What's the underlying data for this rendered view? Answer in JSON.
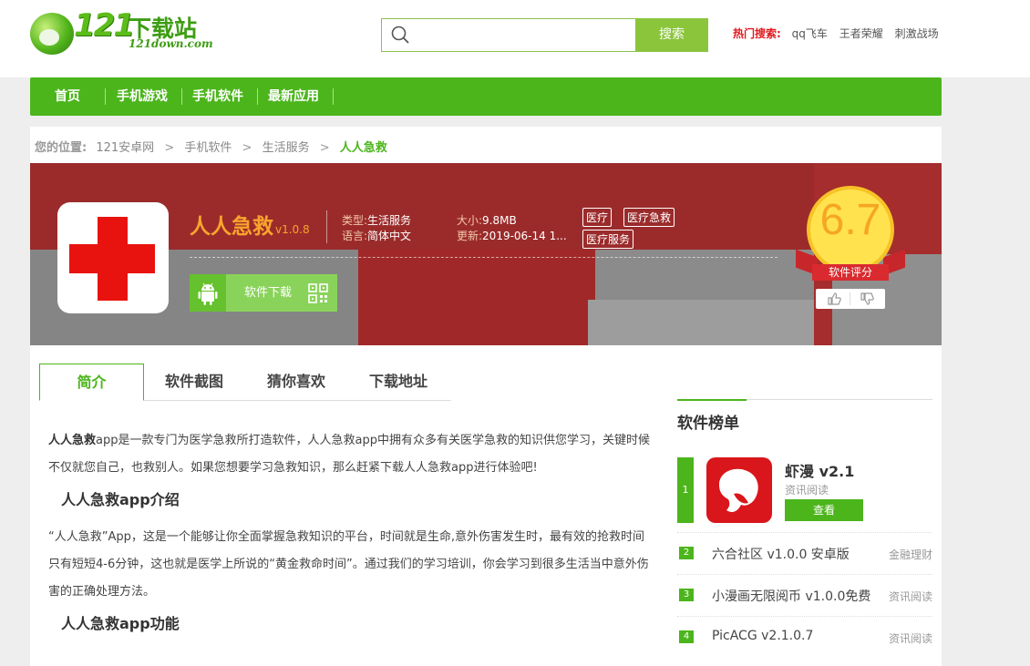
{
  "logo": {
    "number": "121",
    "name": "下载站",
    "domain": "121down.com"
  },
  "search": {
    "placeholder": "",
    "button": "搜索"
  },
  "hot_search": {
    "label": "热门搜索:",
    "items": [
      "qq飞车",
      "王者荣耀",
      "刺激战场"
    ]
  },
  "nav": {
    "items": [
      "首页",
      "手机游戏",
      "手机软件",
      "最新应用"
    ]
  },
  "breadcrumb": {
    "label": "您的位置:",
    "items": [
      "121安卓网",
      "手机软件",
      "生活服务"
    ],
    "current": "人人急救",
    "separator": ">"
  },
  "app": {
    "name": "人人急救",
    "version": "v1.0.8",
    "type_label": "类型:",
    "type": "生活服务",
    "lang_label": "语言:",
    "lang": "简体中文",
    "size_label": "大小:",
    "size": "9.8MB",
    "update_label": "更新:",
    "update": "2019-06-14 1...",
    "tags": [
      "医疗",
      "医疗急救",
      "医疗服务"
    ],
    "download_label": "软件下载",
    "score": "6.7",
    "score_label": "软件评分"
  },
  "tabs": [
    "简介",
    "软件截图",
    "猜你喜欢",
    "下载地址"
  ],
  "content": {
    "intro_bold": "人人急救",
    "intro_rest": "app是一款专门为医学急救所打造软件，人人急救app中拥有众多有关医学急救的知识供您学习，关键时候不仅就您自己，也救别人。如果您想要学习急救知识，那么赶紧下载人人急救app进行体验吧!",
    "h1": "人人急救app介绍",
    "p2": "“人人急救”App，这是一个能够让你全面掌握急救知识的平台，时间就是生命,意外伤害发生时，最有效的抢救时间只有短短4-6分钟，这也就是医学上所说的“黄金救命时间”。通过我们的学习培训，你会学习到很多生活当中意外伤害的正确处理方法。",
    "h2": "人人急救app功能"
  },
  "sidebar": {
    "title": "软件榜单",
    "top": {
      "rank": "1",
      "name": "虾漫 v2.1",
      "category": "资讯阅读",
      "button": "查看"
    },
    "rows": [
      {
        "rank": "2",
        "name": "六合社区 v1.0.0 安卓版",
        "category": "金融理财"
      },
      {
        "rank": "3",
        "name": "小漫画无限阅币 v1.0.0免费",
        "category": "资讯阅读"
      },
      {
        "rank": "4",
        "name": "PicACG v2.1.0.7",
        "category": "资讯阅读"
      }
    ]
  }
}
